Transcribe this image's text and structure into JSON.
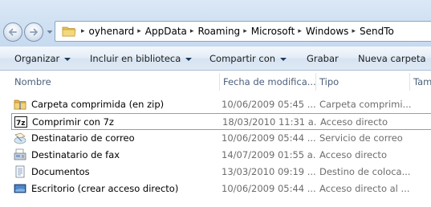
{
  "address": {
    "crumbs": [
      "oyhenard",
      "AppData",
      "Roaming",
      "Microsoft",
      "Windows",
      "SendTo"
    ]
  },
  "toolbar": {
    "organize": "Organizar",
    "include_in_library": "Incluir en biblioteca",
    "share_with": "Compartir con",
    "burn": "Grabar",
    "new_folder": "Nueva carpeta"
  },
  "columns": {
    "name": "Nombre",
    "date": "Fecha de modifica...",
    "type": "Tipo",
    "size": "Tam"
  },
  "files": [
    {
      "name": "Carpeta comprimida (en zip)",
      "date": "10/06/2009 05:45 ...",
      "type": "Carpeta comprimi...",
      "icon": "zip-folder-icon"
    },
    {
      "name": "Comprimir con 7z",
      "date": "18/03/2010 11:31 a...",
      "type": "Acceso directo",
      "icon": "7z-icon"
    },
    {
      "name": "Destinatario de correo",
      "date": "10/06/2009 05:44 ...",
      "type": "Servicio de correo",
      "icon": "mail-recipient-icon"
    },
    {
      "name": "Destinatario de fax",
      "date": "14/07/2009 01:55 a...",
      "type": "Acceso directo",
      "icon": "fax-icon"
    },
    {
      "name": "Documentos",
      "date": "13/03/2010 09:19 ...",
      "type": "Destino de coloca...",
      "icon": "documents-icon"
    },
    {
      "name": "Escritorio (crear acceso directo)",
      "date": "10/06/2009 05:44 ...",
      "type": "Acceso directo al ...",
      "icon": "desktop-icon"
    }
  ]
}
